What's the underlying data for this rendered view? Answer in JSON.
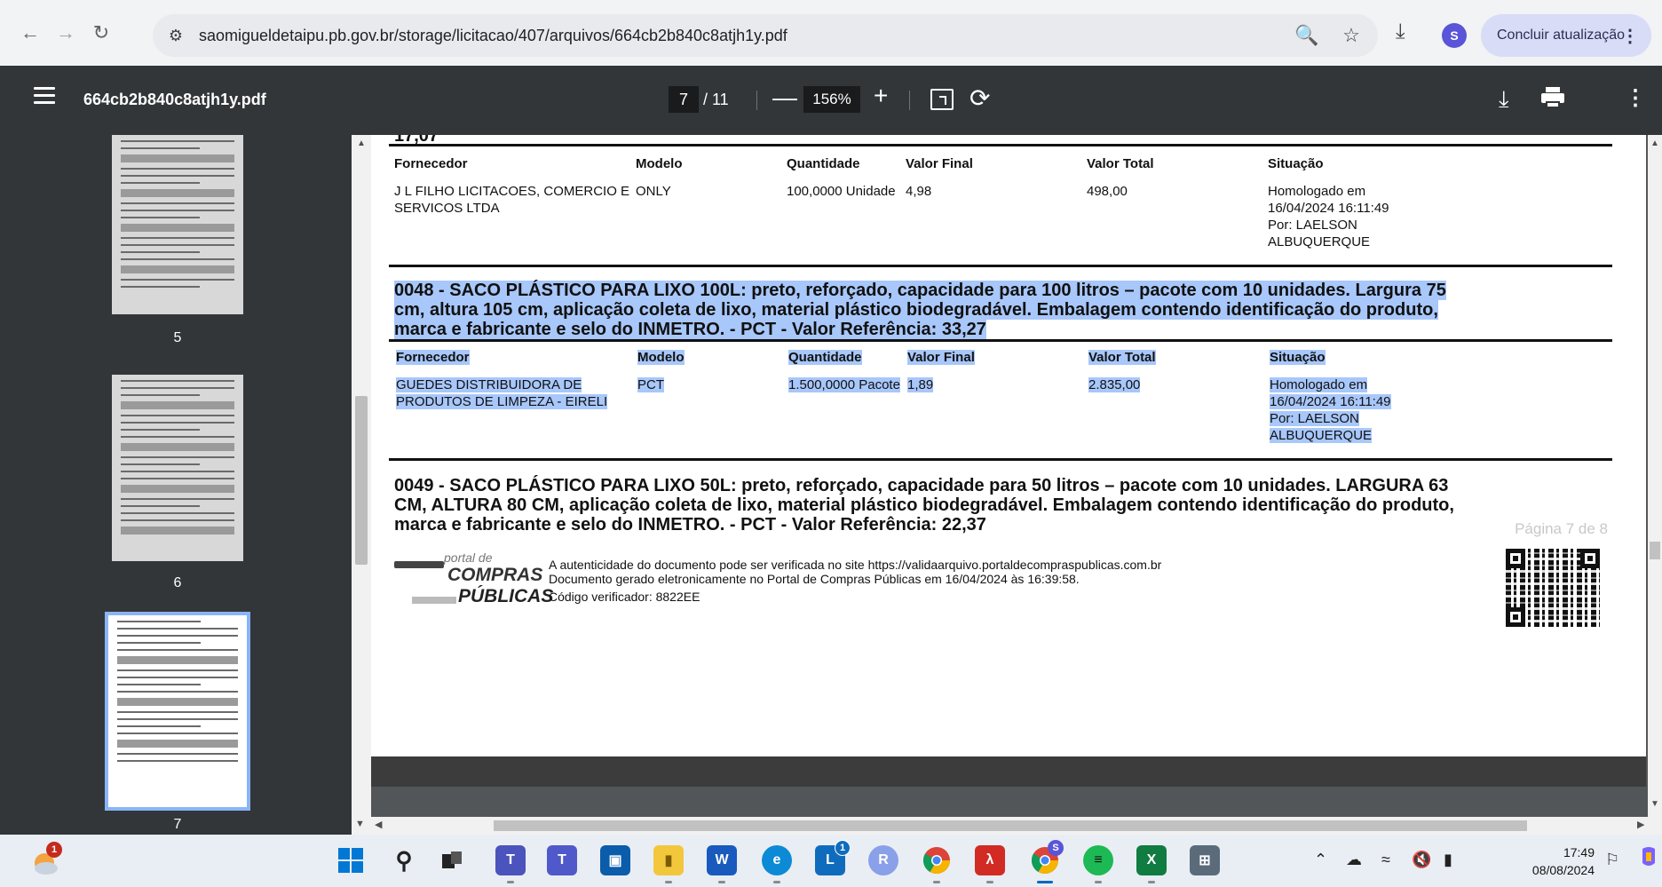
{
  "browser": {
    "url": "saomigueldetaipu.pb.gov.br/storage/licitacao/407/arquivos/664cb2b840c8atjh1y.pdf",
    "profile_initial": "S",
    "update_label": "Concluir atualização",
    "icons": [
      "back-arrow-icon",
      "forward-arrow-icon",
      "reload-icon",
      "site-info-icon",
      "zoom-icon",
      "star-icon",
      "download-icon",
      "more-icon"
    ]
  },
  "pdf_toolbar": {
    "filename": "664cb2b840c8atjh1y.pdf",
    "current_page": "7",
    "total_pages": "/ 11",
    "zoom": "156%"
  },
  "sidebar": {
    "thumbnails": [
      {
        "label": "5"
      },
      {
        "label": "6"
      },
      {
        "label": "7"
      }
    ]
  },
  "document": {
    "cut_top_text": "17,07",
    "table1": {
      "headers": [
        "Fornecedor",
        "Modelo",
        "Quantidade",
        "Valor Final",
        "Valor Total",
        "Situação"
      ],
      "row": {
        "fornecedor": [
          "J L FILHO LICITACOES, COMERCIO E",
          "SERVICOS LTDA"
        ],
        "modelo": "ONLY",
        "quantidade": "100,0000 Unidade",
        "valor_final": "4,98",
        "valor_total": "498,00",
        "situacao": [
          "Homologado em",
          "16/04/2024 16:11:49",
          "Por: LAELSON",
          "ALBUQUERQUE"
        ]
      }
    },
    "item48": {
      "lines": [
        "0048 - SACO PLÁSTICO PARA LIXO 100L: preto, reforçado, capacidade para 100 litros – pacote com 10 unidades. Largura 75",
        "cm, altura 105 cm, aplicação coleta de lixo, material plástico biodegradável. Embalagem contendo identificação do produto,",
        "marca e fabricante e selo do INMETRO. - PCT - Valor Referência: 33,27"
      ]
    },
    "table2": {
      "headers": [
        "Fornecedor",
        "Modelo",
        "Quantidade",
        "Valor Final",
        "Valor Total",
        "Situação"
      ],
      "row": {
        "fornecedor": [
          "GUEDES DISTRIBUIDORA DE",
          "PRODUTOS DE LIMPEZA - EIRELI"
        ],
        "modelo": "PCT",
        "quantidade": "1.500,0000 Pacote",
        "valor_final": "1,89",
        "valor_total": "2.835,00",
        "situacao": [
          "Homologado em",
          "16/04/2024 16:11:49",
          "Por: LAELSON",
          "ALBUQUERQUE"
        ]
      }
    },
    "item49": {
      "lines": [
        "0049 - SACO PLÁSTICO PARA LIXO 50L: preto, reforçado, capacidade para 50 litros – pacote com 10 unidades. LARGURA 63",
        "CM, ALTURA 80 CM, aplicação coleta de lixo, material plástico biodegradável. Embalagem contendo identificação do produto,",
        "marca e fabricante e selo do INMETRO. - PCT - Valor Referência: 22,37"
      ]
    },
    "footer": {
      "pagina": "Página 7 de 8",
      "logo_portal": "portal de",
      "logo_compras": "COMPRAS",
      "logo_publicas": "PÚBLICAS",
      "auth_line": "A autenticidade do documento pode ser verificada no site https://validaarquivo.portaldecompraspublicas.com.br",
      "generated_line": "Documento gerado eletronicamente no Portal de Compras Públicas em 16/04/2024 às 16:39:58.",
      "code_line": "Código verificador: 8822EE"
    }
  },
  "taskbar": {
    "weather_badge": "1",
    "teams_badge": "1",
    "chrome_badge": "S",
    "time": "17:49",
    "date": "08/08/2024",
    "apps": [
      "start-icon",
      "search-icon",
      "task-view-icon",
      "teams-icon",
      "teams-classic-icon",
      "store-icon",
      "file-explorer-icon",
      "word-icon",
      "edge-icon",
      "lync-icon",
      "r-app-icon",
      "chrome-icon",
      "acrobat-icon",
      "chrome-profile-icon",
      "spotify-icon",
      "excel-icon",
      "calculator-icon"
    ]
  },
  "colors": {
    "selection": "#a8c7fa",
    "pdf_toolbar": "#323639",
    "viewer_bg": "#525659",
    "accent": "#5a54d8"
  }
}
